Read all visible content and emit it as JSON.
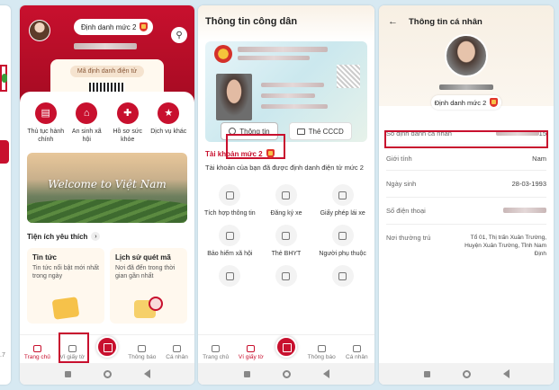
{
  "phone1": {
    "footer_text": ".7"
  },
  "phone2": {
    "badge": "Định danh mức 2",
    "qr_label": "Mã định danh điện tử",
    "services": [
      {
        "label": "Thủ tục hành chính",
        "icon": "document-icon"
      },
      {
        "label": "An sinh xã hội",
        "icon": "house-heart-icon"
      },
      {
        "label": "Hồ sơ sức khỏe",
        "icon": "health-record-icon"
      },
      {
        "label": "Dịch vụ khác",
        "icon": "star-icon"
      }
    ],
    "banner_text": "Welcome to Việt Nam",
    "favorites_title": "Tiện ích yêu thích",
    "cards": [
      {
        "title": "Tin tức",
        "desc": "Tin tức nổi bật mới nhất trong ngày"
      },
      {
        "title": "Lịch sử quét mã",
        "desc": "Nơi đã đến trong thời gian gần nhất"
      }
    ],
    "bottom_nav": [
      {
        "label": "Trang chủ",
        "icon": "home-icon"
      },
      {
        "label": "Ví giấy tờ",
        "icon": "wallet-icon"
      },
      {
        "label": "",
        "icon": "qr-scan-icon"
      },
      {
        "label": "Thông báo",
        "icon": "bell-icon"
      },
      {
        "label": "Cá nhân",
        "icon": "user-icon"
      }
    ]
  },
  "phone3": {
    "title": "Thông tin công dân",
    "tabs": [
      {
        "label": "Thông tin",
        "icon": "info-icon"
      },
      {
        "label": "Thẻ CCCD",
        "icon": "id-card-icon"
      }
    ],
    "account_title": "Tài khoản mức 2",
    "account_desc": "Tài khoản của bạn đã được định danh điện tử mức 2",
    "grid": [
      {
        "label": "Tích hợp thông tin",
        "icon": "integrate-icon"
      },
      {
        "label": "Đăng ký xe",
        "icon": "car-icon"
      },
      {
        "label": "Giấy phép lái xe",
        "icon": "license-icon"
      },
      {
        "label": "Bảo hiểm xã hội",
        "icon": "insurance-icon"
      },
      {
        "label": "Thẻ BHYT",
        "icon": "health-card-icon"
      },
      {
        "label": "Người phụ thuộc",
        "icon": "dependents-icon"
      },
      {
        "label": "",
        "icon": "document-icon"
      },
      {
        "label": "",
        "icon": "passport-icon"
      },
      {
        "label": "",
        "icon": "house-icon"
      }
    ],
    "bottom_nav": [
      {
        "label": "Trang chủ",
        "icon": "home-icon"
      },
      {
        "label": "Ví giấy tờ",
        "icon": "wallet-icon"
      },
      {
        "label": "",
        "icon": "qr-scan-icon"
      },
      {
        "label": "Thông báo",
        "icon": "bell-icon"
      },
      {
        "label": "Cá nhân",
        "icon": "user-icon"
      }
    ]
  },
  "phone4": {
    "title": "Thông tin cá nhân",
    "badge": "Định danh mức 2",
    "rows": [
      {
        "label": "Số định danh cá nhân",
        "value": "15"
      },
      {
        "label": "Giới tính",
        "value": "Nam"
      },
      {
        "label": "Ngày sinh",
        "value": "28-03-1993"
      },
      {
        "label": "Số điện thoại",
        "value": ""
      },
      {
        "label": "Nơi thường trú",
        "value": "Tổ 01, Thị trấn Xuân Trường, Huyện Xuân Trường, Tỉnh Nam Định"
      }
    ]
  },
  "colors": {
    "brand_red": "#c8102e",
    "background": "#d7e9f2"
  }
}
